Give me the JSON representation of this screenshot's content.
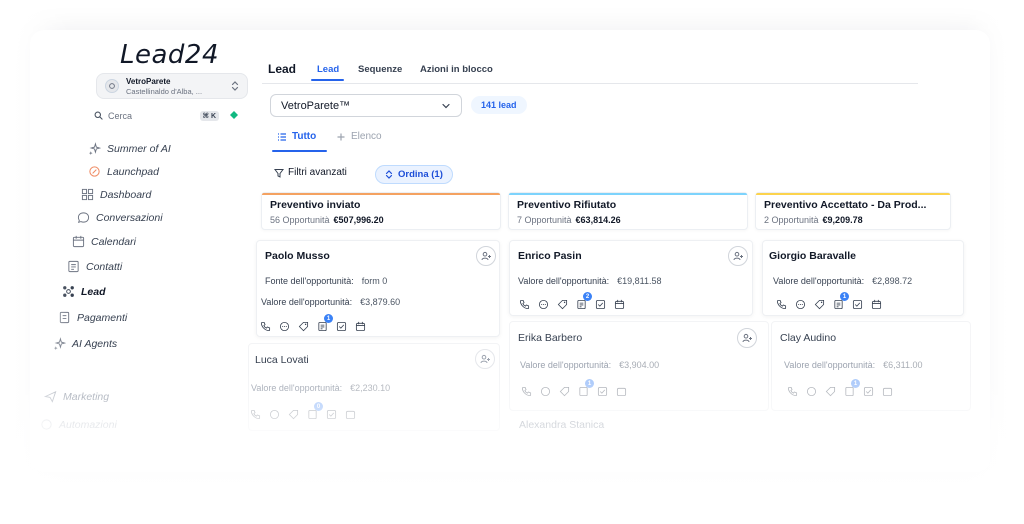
{
  "app": {
    "logo": "Lead24"
  },
  "account": {
    "name": "VetroParete",
    "location": "Castellinaldo d'Alba, ..."
  },
  "search": {
    "placeholder": "Cerca",
    "shortcut": "⌘ K"
  },
  "sidebar": {
    "items": [
      {
        "label": "Summer of AI",
        "icon": "sparkles-icon"
      },
      {
        "label": "Launchpad",
        "icon": "rocket-icon"
      },
      {
        "label": "Dashboard",
        "icon": "dashboard-icon"
      },
      {
        "label": "Conversazioni",
        "icon": "chat-icon"
      },
      {
        "label": "Calendari",
        "icon": "calendar-icon"
      },
      {
        "label": "Contatti",
        "icon": "contacts-icon"
      },
      {
        "label": "Lead",
        "icon": "lead-icon",
        "active": true
      },
      {
        "label": "Pagamenti",
        "icon": "payments-icon"
      },
      {
        "label": "AI Agents",
        "icon": "sparkles-icon"
      },
      {
        "label": "Marketing",
        "icon": "send-icon"
      },
      {
        "label": "Automazioni",
        "icon": "automation-icon"
      }
    ]
  },
  "header": {
    "title": "Lead",
    "tabs": [
      "Lead",
      "Sequenze",
      "Azioni in blocco"
    ],
    "active_tab": "Lead"
  },
  "pipeline": {
    "selected": "VetroParete™",
    "count_label": "141 lead"
  },
  "views": {
    "all": "Tutto",
    "list": "Elenco"
  },
  "filters": {
    "advanced": "Filtri avanzati",
    "sort": "Ordina (1)"
  },
  "colors": {
    "accent": "#2563eb",
    "stage_sent": "#f4a261",
    "stage_rejected": "#7dd3fc",
    "stage_accepted": "#fcd34d"
  },
  "columns": [
    {
      "title": "Preventivo inviato",
      "count": "56 Opportunità",
      "amount": "€507,996.20",
      "cards": [
        {
          "name": "Paolo Musso",
          "fields": [
            {
              "label": "Fonte dell'opportunità:",
              "value": "form 0"
            },
            {
              "label": "Valore dell'opportunità:",
              "value": "€3,879.60"
            }
          ],
          "badge": "1"
        },
        {
          "name": "Luca Lovati",
          "fields": [
            {
              "label": "Valore dell'opportunità:",
              "value": "€2,230.10"
            }
          ],
          "badge": "0"
        }
      ]
    },
    {
      "title": "Preventivo Rifiutato",
      "count": "7 Opportunità",
      "amount": "€63,814.26",
      "cards": [
        {
          "name": "Enrico Pasin",
          "fields": [
            {
              "label": "Valore dell'opportunità:",
              "value": "€19,811.58"
            }
          ],
          "badge": "2"
        },
        {
          "name": "Erika Barbero",
          "fields": [
            {
              "label": "Valore dell'opportunità:",
              "value": "€3,904.00"
            }
          ],
          "badge": "1"
        },
        {
          "name": "Alexandra Stanica"
        }
      ]
    },
    {
      "title": "Preventivo Accettato - Da Prod...",
      "count": "2 Opportunità",
      "amount": "€9,209.78",
      "cards": [
        {
          "name": "Giorgio Baravalle",
          "fields": [
            {
              "label": "Valore dell'opportunità:",
              "value": "€2,898.72"
            }
          ],
          "badge": "1"
        },
        {
          "name": "Clay Audino",
          "fields": [
            {
              "label": "Valore dell'opportunità:",
              "value": "€6,311.00"
            }
          ],
          "badge": "1"
        }
      ]
    }
  ]
}
